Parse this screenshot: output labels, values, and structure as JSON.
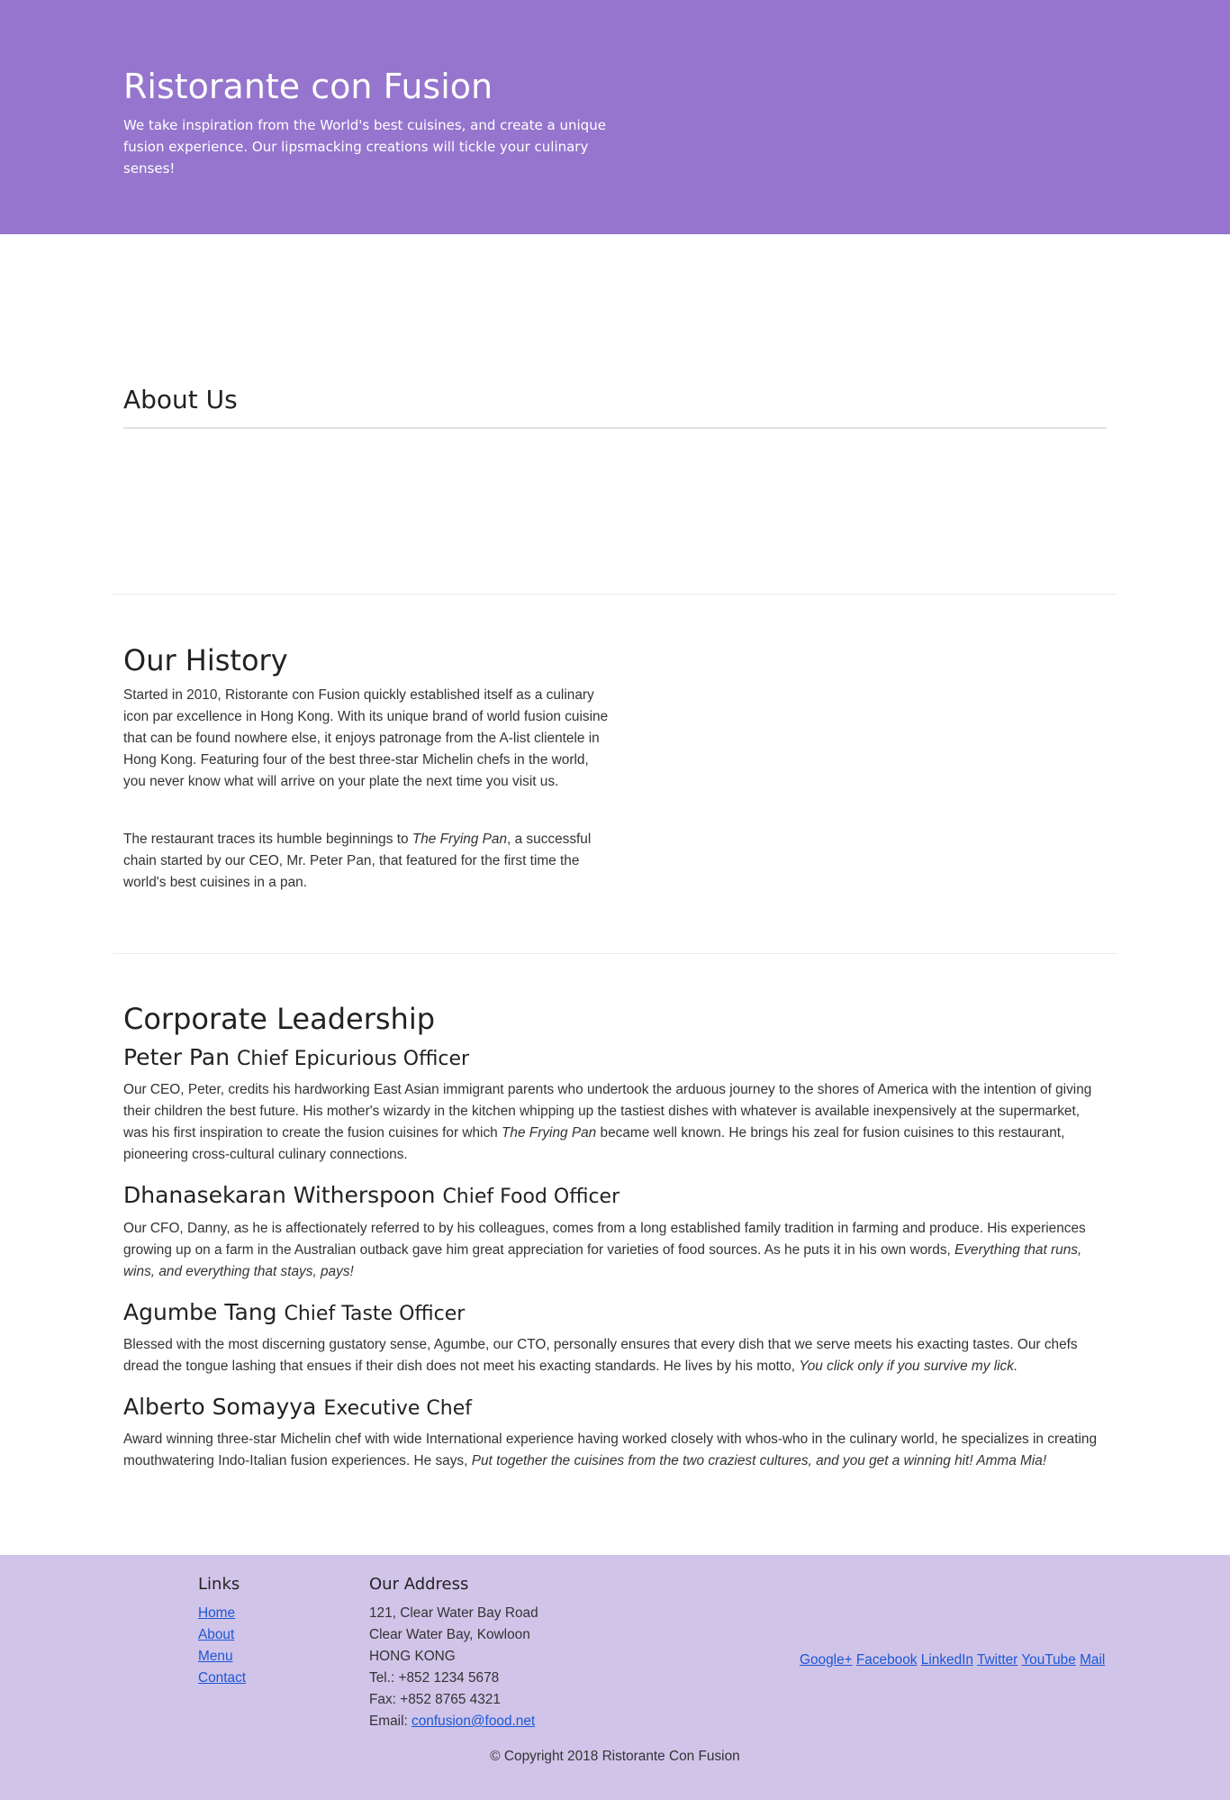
{
  "header": {
    "title": "Ristorante con Fusion",
    "tagline": "We take inspiration from the World's best cuisines, and create a unique fusion experience. Our lipsmacking creations will tickle your culinary senses!"
  },
  "about": {
    "title": "About Us"
  },
  "history": {
    "title": "Our History",
    "p1": "Started in 2010, Ristorante con Fusion quickly established itself as a culinary icon par excellence in Hong Kong. With its unique brand of world fusion cuisine that can be found nowhere else, it enjoys patronage from the A-list clientele in Hong Kong. Featuring four of the best three-star Michelin chefs in the world, you never know what will arrive on your plate the next time you visit us.",
    "p2_before": "The restaurant traces its humble beginnings to ",
    "p2_italic": "The Frying Pan",
    "p2_after": ", a successful chain started by our CEO, Mr. Peter Pan, that featured for the first time the world's best cuisines in a pan."
  },
  "leadership": {
    "title": "Corporate Leadership",
    "leaders": [
      {
        "name": "Peter Pan",
        "role": "Chief Epicurious Officer",
        "bio_before": "Our CEO, Peter, credits his hardworking East Asian immigrant parents who undertook the arduous journey to the shores of America with the intention of giving their children the best future. His mother's wizardy in the kitchen whipping up the tastiest dishes with whatever is available inexpensively at the supermarket, was his first inspiration to create the fusion cuisines for which ",
        "bio_italic": "The Frying Pan",
        "bio_after": " became well known. He brings his zeal for fusion cuisines to this restaurant, pioneering cross-cultural culinary connections."
      },
      {
        "name": "Dhanasekaran Witherspoon",
        "role": "Chief Food Officer",
        "bio_before": "Our CFO, Danny, as he is affectionately referred to by his colleagues, comes from a long established family tradition in farming and produce. His experiences growing up on a farm in the Australian outback gave him great appreciation for varieties of food sources. As he puts it in his own words, ",
        "bio_italic": "Everything that runs, wins, and everything that stays, pays!",
        "bio_after": ""
      },
      {
        "name": "Agumbe Tang",
        "role": "Chief Taste Officer",
        "bio_before": "Blessed with the most discerning gustatory sense, Agumbe, our CTO, personally ensures that every dish that we serve meets his exacting tastes. Our chefs dread the tongue lashing that ensues if their dish does not meet his exacting standards. He lives by his motto, ",
        "bio_italic": "You click only if you survive my lick.",
        "bio_after": ""
      },
      {
        "name": "Alberto Somayya",
        "role": "Executive Chef",
        "bio_before": "Award winning three-star Michelin chef with wide International experience having worked closely with whos-who in the culinary world, he specializes in creating mouthwatering Indo-Italian fusion experiences. He says, ",
        "bio_italic": "Put together the cuisines from the two craziest cultures, and you get a winning hit! Amma Mia!",
        "bio_after": ""
      }
    ]
  },
  "footer": {
    "links_title": "Links",
    "links": [
      "Home",
      "About",
      "Menu",
      "Contact"
    ],
    "address_title": "Our Address",
    "address_lines": [
      "121, Clear Water Bay Road",
      "Clear Water Bay, Kowloon",
      "HONG KONG",
      "Tel.: +852 1234 5678",
      "Fax: +852 8765 4321"
    ],
    "email_label": "Email: ",
    "email": "confusion@food.net",
    "social": [
      "Google+",
      "Facebook",
      "LinkedIn",
      "Twitter",
      "YouTube",
      "Mail"
    ],
    "copyright": "© Copyright 2018 Ristorante Con Fusion"
  },
  "colors": {
    "header_bg": "#9575cd",
    "footer_bg": "#d1c4e9",
    "link": "#1a57d6"
  }
}
